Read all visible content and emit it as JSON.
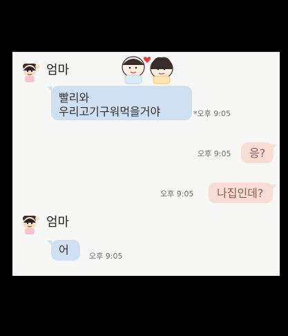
{
  "chat": {
    "messages": [
      {
        "sender": "엄마",
        "text": "빨리와\n우리고기구워먹을거야",
        "time": "오후 9:05",
        "stray": "*"
      },
      {
        "sender": "",
        "text": "응?",
        "time": "오후 9:05"
      },
      {
        "sender": "",
        "text": "나집인데?",
        "time": "오후 9:05"
      },
      {
        "sender": "엄마",
        "text": "어",
        "time": "오후 9:05"
      }
    ]
  },
  "colors": {
    "incoming_bubble": "#cfe0f3",
    "outgoing_bubble": "#f7ddd3",
    "background": "#f7f7f5"
  },
  "icons": {
    "avatar": "mother-avatar-icon",
    "sticker": "couple-sticker-icon",
    "heart": "heart-icon"
  }
}
